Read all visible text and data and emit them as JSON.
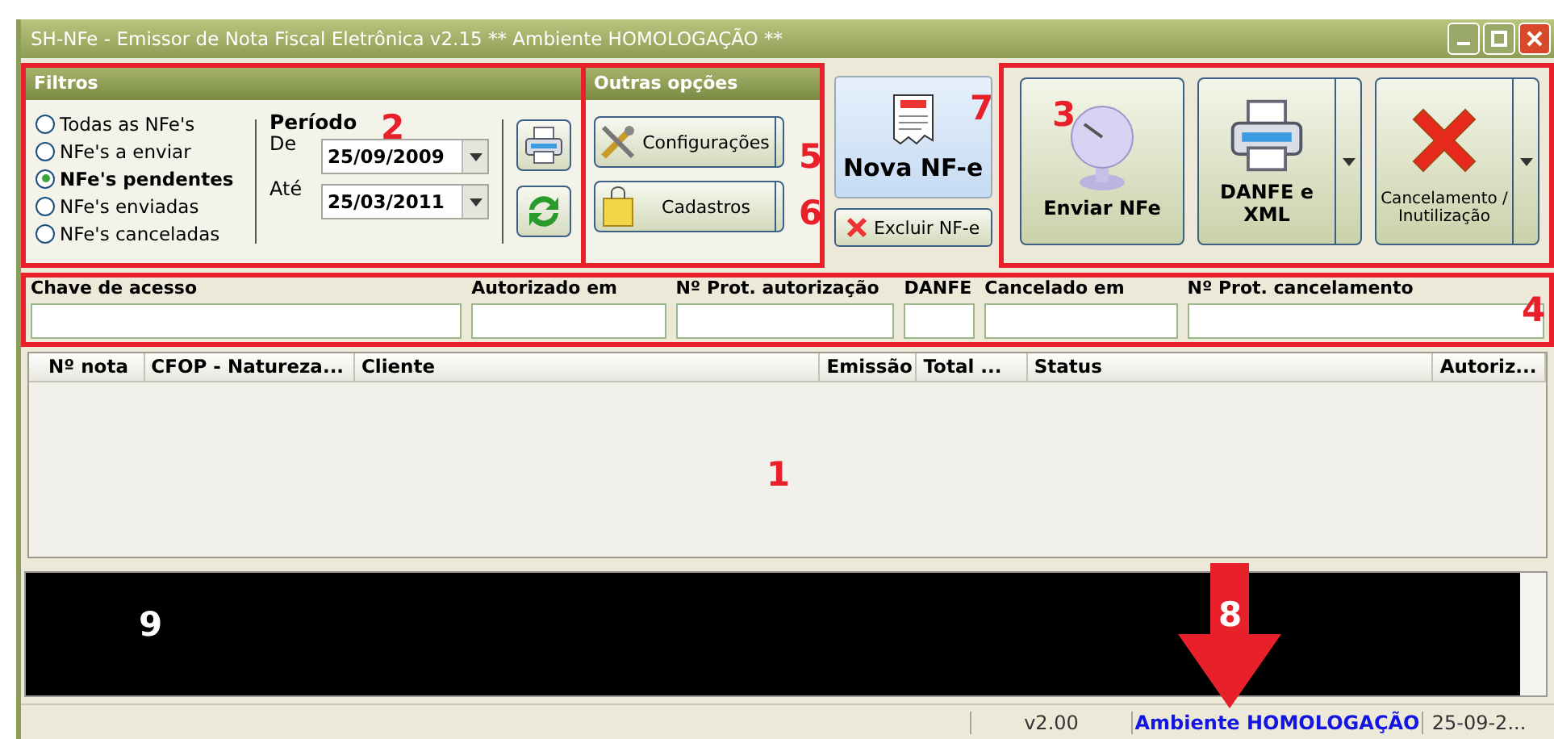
{
  "window": {
    "title": "SH-NFe - Emissor de Nota Fiscal Eletrônica v2.15  ** Ambiente HOMOLOGAÇÃO **"
  },
  "filters": {
    "title": "Filtros",
    "options": [
      {
        "label": "Todas as NFe's",
        "selected": false
      },
      {
        "label": "NFe's a enviar",
        "selected": false
      },
      {
        "label": "NFe's pendentes",
        "selected": true
      },
      {
        "label": "NFe's enviadas",
        "selected": false
      },
      {
        "label": "NFe's canceladas",
        "selected": false
      }
    ],
    "period": {
      "title": "Período",
      "from_label": "De",
      "from": "25/09/2009",
      "to_label": "Até",
      "to": "25/03/2011"
    }
  },
  "other_options": {
    "title": "Outras opções",
    "buttons": [
      {
        "label": "Configurações",
        "kind": "tools"
      },
      {
        "label": "Cadastros",
        "kind": "bag"
      }
    ]
  },
  "new_button": {
    "label": "Nova NF-e"
  },
  "delete_button": {
    "label": "Excluir NF-e"
  },
  "actions": [
    {
      "label": "Enviar NFe",
      "kind": "dish",
      "split": false
    },
    {
      "label": "DANFE e XML",
      "kind": "printer",
      "split": true
    },
    {
      "label": "Cancelamento / Inutilização",
      "kind": "cancel",
      "split": true
    }
  ],
  "fields": [
    {
      "label": "Chave de acesso"
    },
    {
      "label": "Autorizado em"
    },
    {
      "label": "Nº Prot. autorização"
    },
    {
      "label": "DANFE"
    },
    {
      "label": "Cancelado em"
    },
    {
      "label": "Nº Prot. cancelamento"
    }
  ],
  "columns": [
    "Nº nota",
    "CFOP - Natureza...",
    "Cliente",
    "Emissão",
    "Total ...",
    "Status",
    "Autoriz..."
  ],
  "status_bar": [
    {
      "text": "v2.00",
      "kind": "plain"
    },
    {
      "text": "Ambiente HOMOLOGAÇÃO",
      "kind": "env"
    },
    {
      "text": "25-09-2...",
      "kind": "plain"
    }
  ],
  "annotations": [
    "1",
    "2",
    "3",
    "4",
    "5",
    "6",
    "7",
    "8",
    "9"
  ]
}
